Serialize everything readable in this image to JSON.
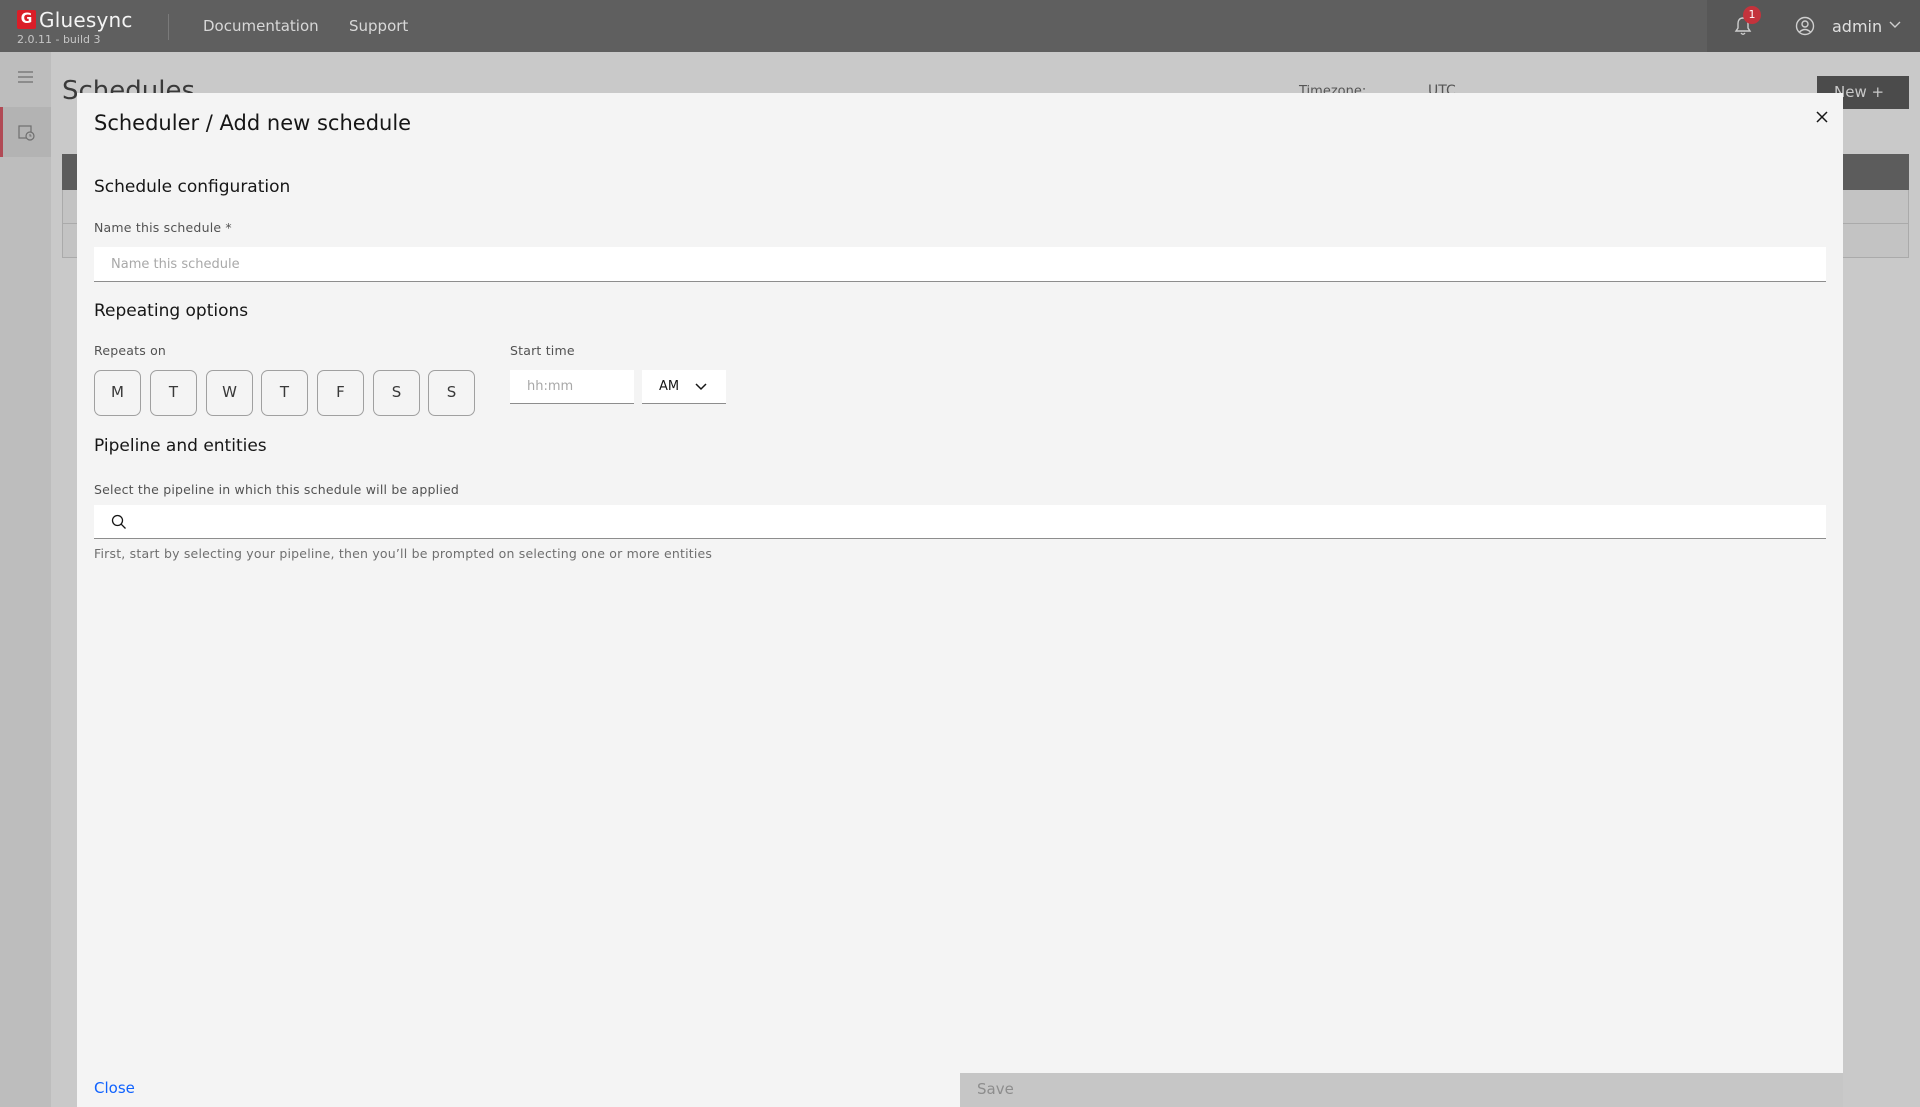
{
  "header": {
    "brand": "Gluesync",
    "version": "2.0.11 - build 3",
    "nav": [
      "Documentation",
      "Support"
    ],
    "notification_count": "1",
    "user": "admin"
  },
  "background_page": {
    "title": "Schedules",
    "timezone_label": "Timezone:",
    "timezone_value": "UTC",
    "new_button": "New  +"
  },
  "modal": {
    "title": "Scheduler / Add new schedule",
    "config_section": "Schedule configuration",
    "name_label": "Name this schedule *",
    "name_placeholder": "Name this schedule",
    "repeating_section": "Repeating options",
    "repeats_label": "Repeats on",
    "days": [
      "M",
      "T",
      "W",
      "T",
      "F",
      "S",
      "S"
    ],
    "start_time_label": "Start time",
    "time_placeholder": "hh:mm",
    "ampm": "AM",
    "pipeline_section": "Pipeline and entities",
    "pipeline_label": "Select the pipeline in which this schedule will be applied",
    "pipeline_helper": "First, start by selecting your pipeline, then you’ll be prompted on selecting one or more entities",
    "close_label": "Close",
    "save_label": "Save"
  }
}
